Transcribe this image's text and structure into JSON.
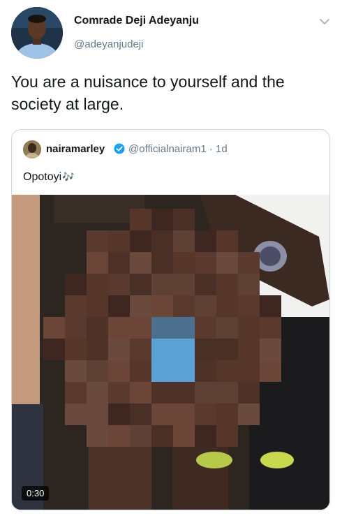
{
  "author": {
    "name": "Comrade Deji Adeyanju",
    "handle": "@adeyanjudeji",
    "avatar_icon": "profile-photo"
  },
  "tweet": {
    "text": "You are a nuisance to yourself and the society at large."
  },
  "quoted_tweet": {
    "name": "nairamarley",
    "verified": true,
    "handle": "@officialnairam1 · 1d",
    "text": "Opotoyi",
    "emoji": "🎶",
    "video": {
      "duration": "0:30",
      "content": "pixelated-video-frame"
    }
  },
  "colors": {
    "text_primary": "#14171a",
    "text_secondary": "#657786",
    "verified_blue": "#1da1f2",
    "border": "#ccd6dd"
  }
}
